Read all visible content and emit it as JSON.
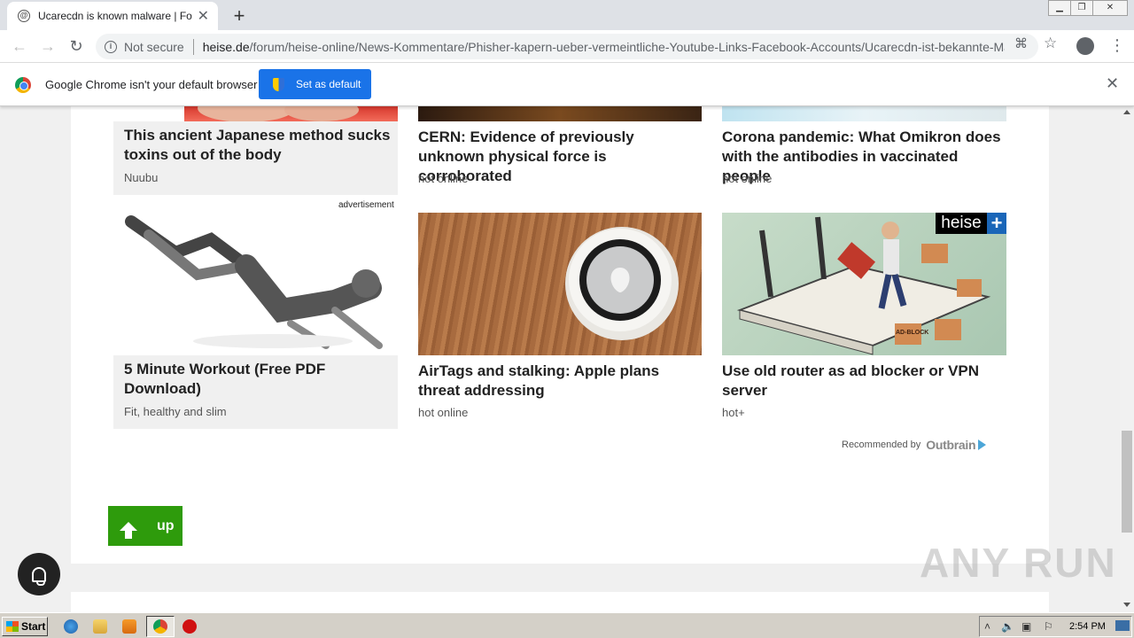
{
  "browser": {
    "tab_title": "Ucarecdn is known malware | Forum",
    "tab_favicon": "@",
    "url_prefix": "Not secure",
    "url_domain": "heise.de",
    "url_path": "/forum/heise-online/News-Kommentare/Phisher-kapern-ueber-vermeintliche-Youtube-Links-Facebook-Accounts/Ucarecdn-ist-bekannte-Mal..."
  },
  "infobar": {
    "message": "Google Chrome isn't your default browser",
    "button_label": "Set as default"
  },
  "ad_label": "advertisement",
  "cards_top": [
    {
      "title": "This ancient Japanese method sucks toxins out of the body",
      "source": "Nuubu"
    },
    {
      "title": "CERN: Evidence of previously unknown physical force is corroborated",
      "source": "hot online"
    },
    {
      "title": "Corona pandemic: What Omikron does with the antibodies in vaccinated people",
      "source": "hot online"
    }
  ],
  "cards_bottom": [
    {
      "title": "5 Minute Workout (Free PDF Download)",
      "source": "Fit, healthy and slim"
    },
    {
      "title": "AirTags and stalking: Apple plans threat addressing",
      "source": "hot online"
    },
    {
      "title": "Use old router as ad blocker or VPN server",
      "source": "hot+"
    }
  ],
  "heise_badge": "heise",
  "heise_plus": "+",
  "router_sticker": "AD-BLOCK",
  "recommended_by": "Recommended by",
  "outbrain": "Outbrain",
  "up_label": "up",
  "watermark": "ANY RUN",
  "taskbar": {
    "start_label": "Start",
    "clock": "2:54 PM"
  },
  "scrollbar": {
    "position_fraction": 0.82,
    "thumb_fraction": 0.21
  },
  "colors": {
    "up_button": "#2e9b0c",
    "set_default": "#1a73e8"
  }
}
